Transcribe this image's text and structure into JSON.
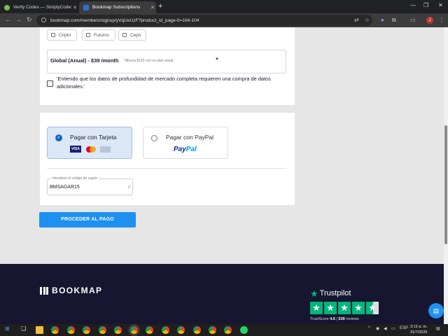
{
  "browser": {
    "tabs": [
      {
        "title": "Verify Codes — SimplyCodes",
        "active": false
      },
      {
        "title": "Bookmap Subscriptions",
        "active": true
      }
    ],
    "url": "bookmap.com/members/signup/yVqUeUzF?product_id_page-0=104-104",
    "profile_initial": "J"
  },
  "filters": {
    "options": [
      {
        "label": "Cripto",
        "checked": false
      },
      {
        "label": "Futuros",
        "checked": false
      },
      {
        "label": "Cepo",
        "checked": false
      }
    ]
  },
  "plan": {
    "name": "Global (Anual) - $39 /month",
    "savings": "*Ahorra $120 con un plan anual"
  },
  "terms": {
    "text": "'Entiendo que los datos de profundidad de mercado completa requieren una compra de datos adicionales.'",
    "checked": false
  },
  "payment": {
    "card_label": "Pagar con Tarjeta",
    "paypal_label": "Pagar con PayPal",
    "paypal_logo_a": "Pay",
    "paypal_logo_b": "Pal",
    "visa": "VISA",
    "selected": "card"
  },
  "coupon": {
    "label": "Introduce el código de cupón",
    "value": "BMSAGAR15"
  },
  "proceed_label": "PROCEDER AL PAGO",
  "footer": {
    "brand": "BOOKMAP",
    "trustpilot": {
      "name": "Trustpilot",
      "score_label": "TrustScore",
      "score": "4.6",
      "reviews": "539",
      "reviews_label": "reviews",
      "rating": 4.6
    }
  },
  "taskbar": {
    "language": "ESP",
    "time": "3:13 a. m.",
    "date": "31/7/2025"
  },
  "colors": {
    "accent": "#1e90f0",
    "footer_bg": "#161630",
    "trustpilot_green": "#00b67a"
  }
}
